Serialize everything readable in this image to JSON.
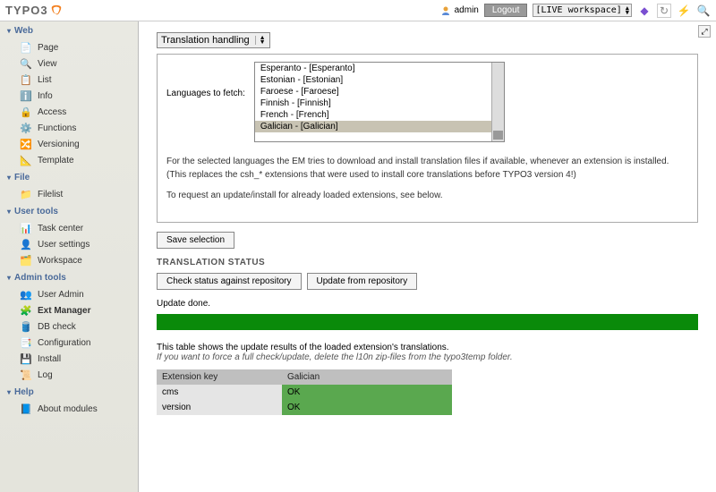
{
  "brand": "TYPO3",
  "top": {
    "user": "admin",
    "logout": "Logout",
    "workspace": "[LIVE workspace]"
  },
  "sidebar": {
    "web": {
      "title": "Web",
      "items": [
        "Page",
        "View",
        "List",
        "Info",
        "Access",
        "Functions",
        "Versioning",
        "Template"
      ]
    },
    "file": {
      "title": "File",
      "items": [
        "Filelist"
      ]
    },
    "usertools": {
      "title": "User tools",
      "items": [
        "Task center",
        "User settings",
        "Workspace"
      ]
    },
    "admintools": {
      "title": "Admin tools",
      "items": [
        "User Admin",
        "Ext Manager",
        "DB check",
        "Configuration",
        "Install",
        "Log"
      ]
    },
    "help": {
      "title": "Help",
      "items": [
        "About modules"
      ]
    }
  },
  "main": {
    "dropdown": "Translation handling",
    "lang_label": "Languages to fetch:",
    "languages": [
      "Esperanto - [Esperanto]",
      "Estonian - [Estonian]",
      "Faroese - [Faroese]",
      "Finnish - [Finnish]",
      "French - [French]",
      "Galician - [Galician]"
    ],
    "desc1": "For the selected languages the EM tries to download and install translation files if available, whenever an extension is installed. (This replaces the csh_* extensions that were used to install core translations before TYPO3 version 4!)",
    "desc2": "To request an update/install for already loaded extensions, see below.",
    "save_btn": "Save selection",
    "status_title": "TRANSLATION STATUS",
    "check_btn": "Check status against repository",
    "update_btn": "Update from repository",
    "update_msg": "Update done.",
    "note1": "This table shows the update results of the loaded extension's translations.",
    "note2": "If you want to force a full check/update, delete the l10n zip-files from the typo3temp folder.",
    "table": {
      "h1": "Extension key",
      "h2": "Galician",
      "rows": [
        {
          "k": "cms",
          "v": "OK"
        },
        {
          "k": "version",
          "v": "OK"
        }
      ]
    }
  }
}
